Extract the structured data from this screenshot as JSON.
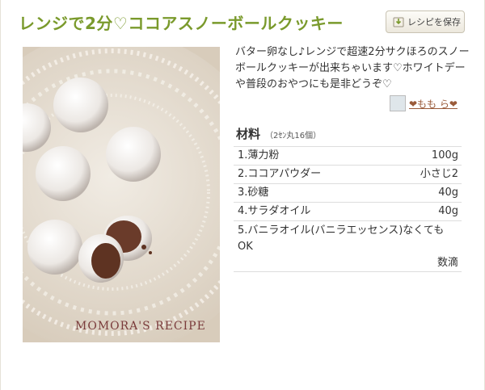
{
  "title": "レンジで2分♡ココアスノーボールクッキー",
  "save_button": {
    "label": "レシピを保存",
    "icon": "save-recipe-icon"
  },
  "photo": {
    "caption": "MOMORA'S RECIPE"
  },
  "description": "バター卵なし♪レンジで超速2分サクほろのスノーボールクッキーが出来ちゃいます♡ホワイトデーや普段のおやつにも是非どうぞ♡",
  "author": {
    "name": "❤もも ら❤"
  },
  "ingredients": {
    "title": "材料",
    "serving": "（2ｾﾝ丸16個）",
    "items": [
      {
        "name": "1.薄力粉",
        "amount": "100g"
      },
      {
        "name": "2.ココアパウダー",
        "amount": "小さじ2"
      },
      {
        "name": "3.砂糖",
        "amount": "40g"
      },
      {
        "name": "4.サラダオイル",
        "amount": "40g"
      },
      {
        "name": "5.バニラオイル(バニラエッセンス)なくてもOK",
        "amount": "数滴"
      }
    ]
  }
}
